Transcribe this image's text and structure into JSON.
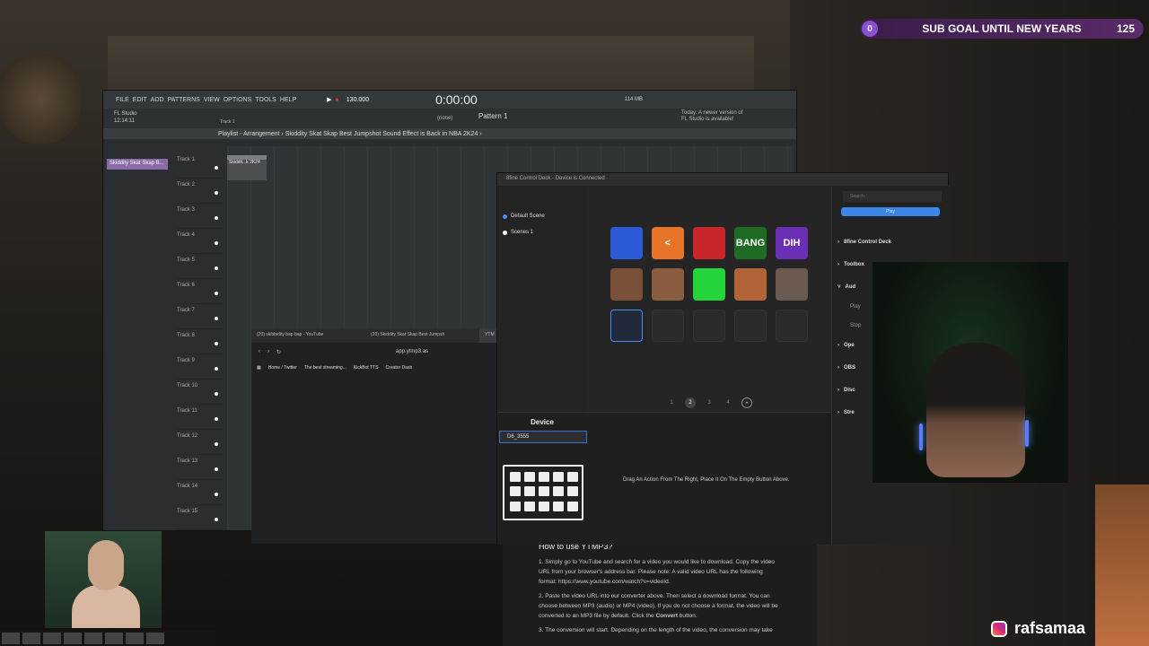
{
  "subgoal": {
    "badge": "0",
    "label": "SUB GOAL UNTIL NEW YEARS",
    "count": "125"
  },
  "fl": {
    "menu": [
      "FILE",
      "EDIT",
      "ADD",
      "PATTERNS",
      "VIEW",
      "OPTIONS",
      "TOOLS",
      "HELP"
    ],
    "tempo": "130.000",
    "time": "0:00:00",
    "app_title": "FL Studio",
    "app_clock": "12:14:11",
    "track_hint": "Track 1",
    "pattern": "Pattern 1",
    "none": "(none)",
    "news": "Today: A newer version of FL Studio is available!",
    "playlist_title": "Playlist - Arrangement › Skiddity Skat Skap Best Jumpshot Sound Effect is Back in NBA 2K24 ›",
    "channel": "Skiddity Skat Skap B...",
    "clip": "Skiddit...k 2K24",
    "mem": "114 MB",
    "tracks": [
      "Track 1",
      "Track 2",
      "Track 3",
      "Track 4",
      "Track 5",
      "Track 6",
      "Track 7",
      "Track 8",
      "Track 9",
      "Track 10",
      "Track 11",
      "Track 12",
      "Track 13",
      "Track 14",
      "Track 15"
    ]
  },
  "browser": {
    "tabs": [
      "(20) skibbidity bap bap - YouTube",
      "(20) Skiddity Skat Skap Best Jumpsh",
      "YTM"
    ],
    "url": "app.ytmp3.as",
    "bookmarks": [
      "Home / Twitter",
      "The best streaming...",
      "KickBot TTS",
      "Creator Dash"
    ]
  },
  "ytmp3": {
    "heading": "How to use YTMP3?",
    "p1": "1. Simply go to YouTube and search for a video you would like to download. Copy the video URL from your browser's address bar. Please note: A valid video URL has the following format: https://www.youtube.com/watch?v=videoId.",
    "p2a": "2. Paste the video URL into our converter above. Then select a download format. You can choose between MP3 (audio) or MP4 (video). If you do not choose a format, the video will be converted to an MP3 file by default. Click the ",
    "p2b": "Convert",
    "p2c": " button.",
    "p3": "3. The conversion will start. Depending on the length of the video, the conversion may take"
  },
  "deck": {
    "title": "8fine Control Deck - Device is Connected",
    "scenes": [
      "Default Scene",
      "Scenes 1"
    ],
    "pages": [
      "1",
      "2",
      "3",
      "4"
    ],
    "device_label": "Device",
    "device_value": "D6_3555",
    "hint": "Drag An Action From The Right, Place It On The Empty Button Above.",
    "search": "Search",
    "play_label": "Play",
    "categories": [
      "8fine Control Deck",
      "Toolbox",
      "Aud",
      "Play",
      "Stop",
      "Ope",
      "OBS",
      "Disc",
      "Stre"
    ],
    "buttons": [
      {
        "label": "",
        "color": "#2b5bd7"
      },
      {
        "label": "<",
        "color": "#e8742a"
      },
      {
        "label": "",
        "color": "#c8262b"
      },
      {
        "label": "BANG",
        "color": "#1d6a23"
      },
      {
        "label": "DIH",
        "color": "#6b2fb5"
      },
      {
        "label": "",
        "color": "#7a5038"
      },
      {
        "label": "",
        "color": "#8a5c40"
      },
      {
        "label": "",
        "color": "#23d43a"
      },
      {
        "label": "",
        "color": "#b06438"
      },
      {
        "label": "",
        "color": "#6a5a50"
      }
    ]
  },
  "handle": "rafsamaa"
}
